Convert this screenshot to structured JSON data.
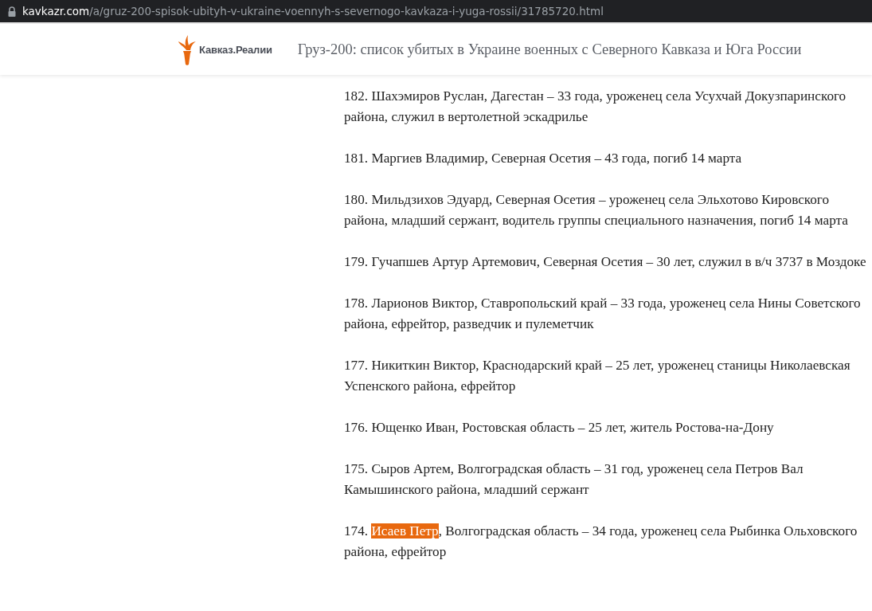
{
  "address_bar": {
    "host": "kavkazr.com",
    "path": "/a/gruz-200-spisok-ubityh-v-ukraine-voennyh-s-severnogo-kavkaza-i-yuga-rossii/31785720.html"
  },
  "header": {
    "logo": "Кавказ.Реалии",
    "title": "Груз-200: список убитых в Украине военных с Северного Кавказа и Юга России"
  },
  "entries": [
    {
      "segments": [
        {
          "text": "182. Шахэмиров Руслан, Дагестан – 33 года, уроженец села Усухчай Докузпаринского района, служил в вертолетной эскадрилье",
          "highlighted": false
        }
      ]
    },
    {
      "segments": [
        {
          "text": "181. Маргиев Владимир, Северная Осетия – 43 года, погиб 14 марта",
          "highlighted": false
        }
      ]
    },
    {
      "segments": [
        {
          "text": "180. Мильдзихов Эдуард, Северная Осетия – уроженец села Эльхотово Кировского района, младший сержант, водитель группы специального назначения, погиб 14 марта",
          "highlighted": false
        }
      ]
    },
    {
      "segments": [
        {
          "text": "179. Гучапшев Артур Артемович, Северная Осетия – 30 лет, служил в в/ч 3737 в Моздоке",
          "highlighted": false
        }
      ]
    },
    {
      "segments": [
        {
          "text": "178. Ларионов Виктор, Ставропольский край – 33 года, уроженец села Нины Советского района, ефрейтор, разведчик и пулеметчик",
          "highlighted": false
        }
      ]
    },
    {
      "segments": [
        {
          "text": "177. Никиткин Виктор, Краснодарский край – 25 лет, уроженец станицы Николаевская Успенского района, ефрейтор",
          "highlighted": false
        }
      ]
    },
    {
      "segments": [
        {
          "text": "176. Ющенко Иван, Ростовская область – 25 лет, житель Ростова-на-Дону",
          "highlighted": false
        }
      ]
    },
    {
      "segments": [
        {
          "text": "175. Сыров Артем, Волгоградская область – 31 год, уроженец села Петров Вал Камышинского района, младший сержант",
          "highlighted": false
        }
      ]
    },
    {
      "segments": [
        {
          "text": "174. ",
          "highlighted": false
        },
        {
          "text": "Исаев Петр",
          "highlighted": true
        },
        {
          "text": ", Волгоградская область – 34 года, уроженец села Рыбинка Ольховского района, ефрейтор",
          "highlighted": false
        }
      ]
    }
  ]
}
